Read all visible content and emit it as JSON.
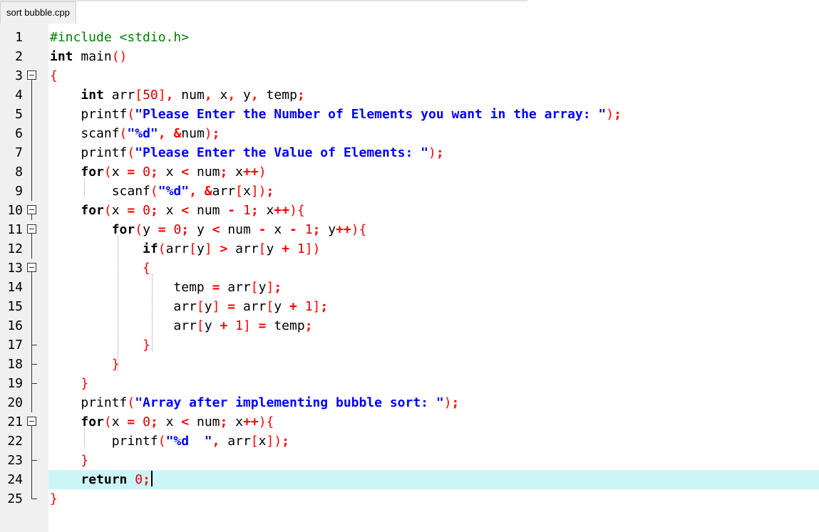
{
  "editor": {
    "tab_title": "sort bubble.cpp",
    "current_line": 24,
    "lines": [
      {
        "n": "1",
        "tokens": [
          [
            "pp",
            "#include <stdio.h>"
          ]
        ]
      },
      {
        "n": "2",
        "tokens": [
          [
            "kw",
            "int"
          ],
          [
            "",
            " main"
          ],
          [
            "br",
            "()"
          ]
        ]
      },
      {
        "n": "3",
        "tokens": [
          [
            "br",
            "{"
          ]
        ]
      },
      {
        "n": "4",
        "tokens": [
          [
            "",
            "    "
          ],
          [
            "kw",
            "int"
          ],
          [
            "",
            " arr"
          ],
          [
            "br",
            "["
          ],
          [
            "num",
            "50"
          ],
          [
            "br",
            "]"
          ],
          [
            "op",
            ","
          ],
          [
            "",
            " num"
          ],
          [
            "op",
            ","
          ],
          [
            "",
            " x"
          ],
          [
            "op",
            ","
          ],
          [
            "",
            " y"
          ],
          [
            "op",
            ","
          ],
          [
            "",
            " temp"
          ],
          [
            "op",
            ";"
          ]
        ]
      },
      {
        "n": "5",
        "tokens": [
          [
            "",
            "    printf"
          ],
          [
            "br",
            "("
          ],
          [
            "str",
            "\"Please Enter the Number of Elements you want in the array: \""
          ],
          [
            "br",
            ")"
          ],
          [
            "op",
            ";"
          ]
        ]
      },
      {
        "n": "6",
        "tokens": [
          [
            "",
            "    scanf"
          ],
          [
            "br",
            "("
          ],
          [
            "str",
            "\"%d\""
          ],
          [
            "op",
            ","
          ],
          [
            "",
            " "
          ],
          [
            "op",
            "&"
          ],
          [
            "",
            "num"
          ],
          [
            "br",
            ")"
          ],
          [
            "op",
            ";"
          ]
        ]
      },
      {
        "n": "7",
        "tokens": [
          [
            "",
            "    printf"
          ],
          [
            "br",
            "("
          ],
          [
            "str",
            "\"Please Enter the Value of Elements: \""
          ],
          [
            "br",
            ")"
          ],
          [
            "op",
            ";"
          ]
        ]
      },
      {
        "n": "8",
        "tokens": [
          [
            "",
            "    "
          ],
          [
            "kw",
            "for"
          ],
          [
            "br",
            "("
          ],
          [
            "",
            "x "
          ],
          [
            "op",
            "="
          ],
          [
            "",
            " "
          ],
          [
            "num",
            "0"
          ],
          [
            "op",
            ";"
          ],
          [
            "",
            " x "
          ],
          [
            "op",
            "<"
          ],
          [
            "",
            " num"
          ],
          [
            "op",
            ";"
          ],
          [
            "",
            " x"
          ],
          [
            "op",
            "++"
          ],
          [
            "br",
            ")"
          ]
        ]
      },
      {
        "n": "9",
        "tokens": [
          [
            "",
            "        scanf"
          ],
          [
            "br",
            "("
          ],
          [
            "str",
            "\"%d\""
          ],
          [
            "op",
            ","
          ],
          [
            "",
            " "
          ],
          [
            "op",
            "&"
          ],
          [
            "",
            "arr"
          ],
          [
            "br",
            "["
          ],
          [
            "",
            "x"
          ],
          [
            "br",
            "])"
          ],
          [
            "op",
            ";"
          ]
        ]
      },
      {
        "n": "10",
        "tokens": [
          [
            "",
            "    "
          ],
          [
            "kw",
            "for"
          ],
          [
            "br",
            "("
          ],
          [
            "",
            "x "
          ],
          [
            "op",
            "="
          ],
          [
            "",
            " "
          ],
          [
            "num",
            "0"
          ],
          [
            "op",
            ";"
          ],
          [
            "",
            " x "
          ],
          [
            "op",
            "<"
          ],
          [
            "",
            " num "
          ],
          [
            "op",
            "-"
          ],
          [
            "",
            " "
          ],
          [
            "num",
            "1"
          ],
          [
            "op",
            ";"
          ],
          [
            "",
            " x"
          ],
          [
            "op",
            "++"
          ],
          [
            "br",
            "){"
          ]
        ]
      },
      {
        "n": "11",
        "tokens": [
          [
            "",
            "        "
          ],
          [
            "kw",
            "for"
          ],
          [
            "br",
            "("
          ],
          [
            "",
            "y "
          ],
          [
            "op",
            "="
          ],
          [
            "",
            " "
          ],
          [
            "num",
            "0"
          ],
          [
            "op",
            ";"
          ],
          [
            "",
            " y "
          ],
          [
            "op",
            "<"
          ],
          [
            "",
            " num "
          ],
          [
            "op",
            "-"
          ],
          [
            "",
            " x "
          ],
          [
            "op",
            "-"
          ],
          [
            "",
            " "
          ],
          [
            "num",
            "1"
          ],
          [
            "op",
            ";"
          ],
          [
            "",
            " y"
          ],
          [
            "op",
            "++"
          ],
          [
            "br",
            "){"
          ]
        ]
      },
      {
        "n": "12",
        "tokens": [
          [
            "",
            "            "
          ],
          [
            "kw",
            "if"
          ],
          [
            "br",
            "("
          ],
          [
            "",
            "arr"
          ],
          [
            "br",
            "["
          ],
          [
            "",
            "y"
          ],
          [
            "br",
            "]"
          ],
          [
            "",
            " "
          ],
          [
            "op",
            ">"
          ],
          [
            "",
            " arr"
          ],
          [
            "br",
            "["
          ],
          [
            "",
            "y "
          ],
          [
            "op",
            "+"
          ],
          [
            "",
            " "
          ],
          [
            "num",
            "1"
          ],
          [
            "br",
            "])"
          ]
        ]
      },
      {
        "n": "13",
        "tokens": [
          [
            "",
            "            "
          ],
          [
            "br",
            "{"
          ]
        ]
      },
      {
        "n": "14",
        "tokens": [
          [
            "",
            "                temp "
          ],
          [
            "op",
            "="
          ],
          [
            "",
            " arr"
          ],
          [
            "br",
            "["
          ],
          [
            "",
            "y"
          ],
          [
            "br",
            "]"
          ],
          [
            "op",
            ";"
          ]
        ]
      },
      {
        "n": "15",
        "tokens": [
          [
            "",
            "                arr"
          ],
          [
            "br",
            "["
          ],
          [
            "",
            "y"
          ],
          [
            "br",
            "]"
          ],
          [
            "",
            " "
          ],
          [
            "op",
            "="
          ],
          [
            "",
            " arr"
          ],
          [
            "br",
            "["
          ],
          [
            "",
            "y "
          ],
          [
            "op",
            "+"
          ],
          [
            "",
            " "
          ],
          [
            "num",
            "1"
          ],
          [
            "br",
            "]"
          ],
          [
            "op",
            ";"
          ]
        ]
      },
      {
        "n": "16",
        "tokens": [
          [
            "",
            "                arr"
          ],
          [
            "br",
            "["
          ],
          [
            "",
            "y "
          ],
          [
            "op",
            "+"
          ],
          [
            "",
            " "
          ],
          [
            "num",
            "1"
          ],
          [
            "br",
            "]"
          ],
          [
            "",
            " "
          ],
          [
            "op",
            "="
          ],
          [
            "",
            " temp"
          ],
          [
            "op",
            ";"
          ]
        ]
      },
      {
        "n": "17",
        "tokens": [
          [
            "",
            "            "
          ],
          [
            "br",
            "}"
          ]
        ]
      },
      {
        "n": "18",
        "tokens": [
          [
            "",
            "        "
          ],
          [
            "br",
            "}"
          ]
        ]
      },
      {
        "n": "19",
        "tokens": [
          [
            "",
            "    "
          ],
          [
            "br",
            "}"
          ]
        ]
      },
      {
        "n": "20",
        "tokens": [
          [
            "",
            "    printf"
          ],
          [
            "br",
            "("
          ],
          [
            "str",
            "\"Array after implementing bubble sort: \""
          ],
          [
            "br",
            ")"
          ],
          [
            "op",
            ";"
          ]
        ]
      },
      {
        "n": "21",
        "tokens": [
          [
            "",
            "    "
          ],
          [
            "kw",
            "for"
          ],
          [
            "br",
            "("
          ],
          [
            "",
            "x "
          ],
          [
            "op",
            "="
          ],
          [
            "",
            " "
          ],
          [
            "num",
            "0"
          ],
          [
            "op",
            ";"
          ],
          [
            "",
            " x "
          ],
          [
            "op",
            "<"
          ],
          [
            "",
            " num"
          ],
          [
            "op",
            ";"
          ],
          [
            "",
            " x"
          ],
          [
            "op",
            "++"
          ],
          [
            "br",
            "){"
          ]
        ]
      },
      {
        "n": "22",
        "tokens": [
          [
            "",
            "        printf"
          ],
          [
            "br",
            "("
          ],
          [
            "str",
            "\"%d  \""
          ],
          [
            "op",
            ","
          ],
          [
            "",
            " arr"
          ],
          [
            "br",
            "["
          ],
          [
            "",
            "x"
          ],
          [
            "br",
            "])"
          ],
          [
            "op",
            ";"
          ]
        ]
      },
      {
        "n": "23",
        "tokens": [
          [
            "",
            "    "
          ],
          [
            "br",
            "}"
          ]
        ]
      },
      {
        "n": "24",
        "tokens": [
          [
            "",
            "    "
          ],
          [
            "kw",
            "return"
          ],
          [
            "",
            " "
          ],
          [
            "num",
            "0"
          ],
          [
            "op",
            ";"
          ]
        ]
      },
      {
        "n": "25",
        "tokens": [
          [
            "br",
            "}"
          ]
        ]
      }
    ]
  },
  "fold_markers": {
    "3": "box",
    "10": "box",
    "11": "box",
    "13": "box",
    "21": "box",
    "4": "line",
    "5": "line",
    "6": "line",
    "7": "line",
    "8": "line",
    "9": "line",
    "12": "line",
    "14": "line",
    "15": "line",
    "16": "line",
    "20": "line",
    "22": "line",
    "24": "line",
    "17": "tick",
    "18": "tick",
    "19": "tick",
    "23": "tick",
    "25": "end"
  }
}
